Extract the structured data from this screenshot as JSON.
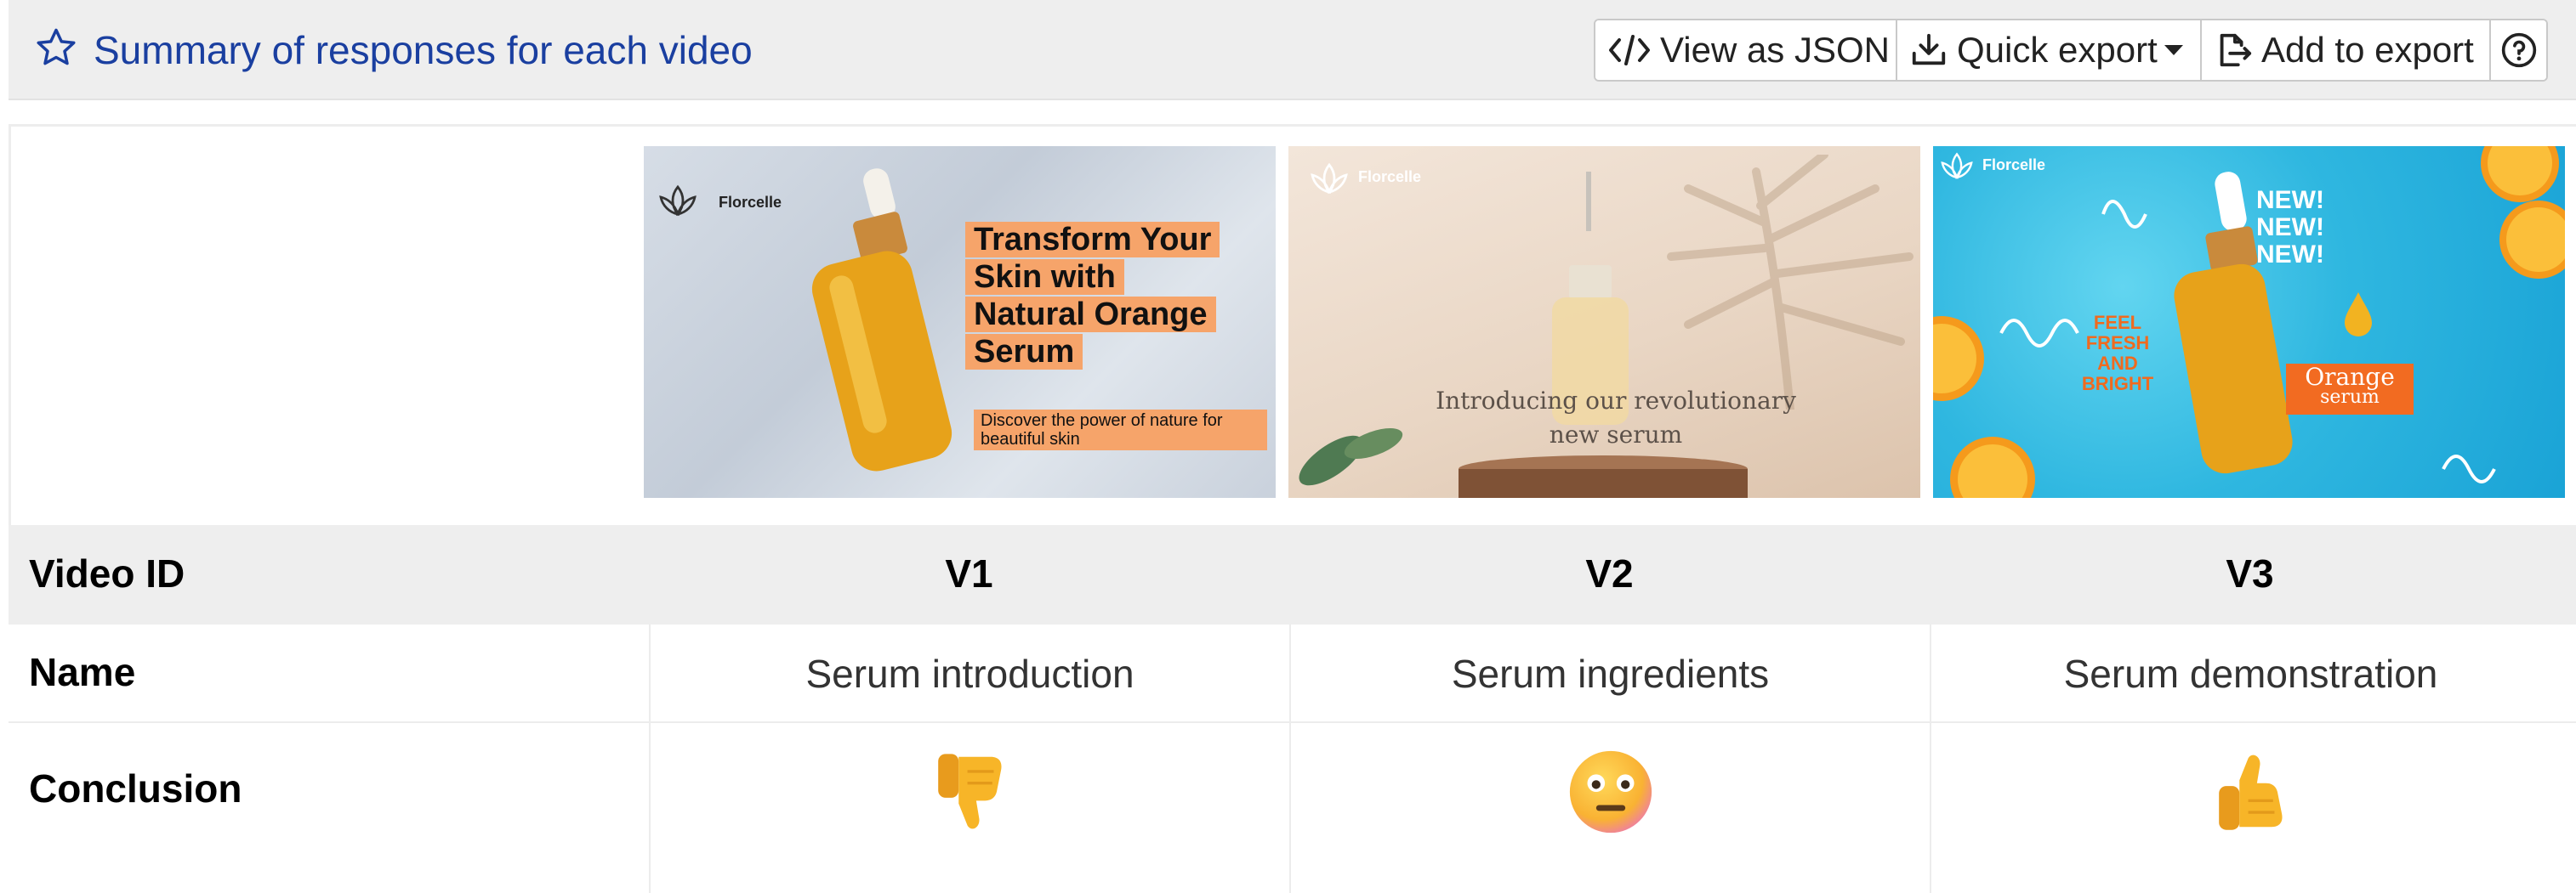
{
  "header": {
    "title": "Summary of responses for each video",
    "buttons": {
      "view_json": "View as JSON",
      "quick_export": "Quick export",
      "add_to_export": "Add to export"
    }
  },
  "thumbnails": [
    {
      "brand": "Florcelle",
      "headline_lines": [
        "Transform Your",
        "Skin with",
        "Natural Orange",
        "Serum"
      ],
      "subline": "Discover the power of nature for beautiful skin"
    },
    {
      "brand": "Florcelle",
      "caption_lines": [
        "Introducing our revolutionary",
        "new serum"
      ]
    },
    {
      "brand": "Florcelle",
      "new_lines": [
        "NEW!",
        "NEW!",
        "NEW!"
      ],
      "fresh_lines": [
        "FEEL",
        "FRESH",
        "AND",
        "BRIGHT"
      ],
      "product_lines": [
        "Orange",
        "serum"
      ]
    }
  ],
  "table": {
    "labels": {
      "video_id": "Video ID",
      "name": "Name",
      "conclusion": "Conclusion"
    },
    "columns": [
      {
        "id": "V1",
        "name": "Serum introduction",
        "conclusion_icon": "thumbs-down"
      },
      {
        "id": "V2",
        "name": "Serum ingredients",
        "conclusion_icon": "neutral-face"
      },
      {
        "id": "V3",
        "name": "Serum demonstration",
        "conclusion_icon": "thumbs-up"
      }
    ]
  },
  "colors": {
    "title": "#1a3fa0",
    "header_bg": "#eeeeee",
    "emoji_yellow": "#f7b528",
    "thumb_accent": "#f6a46a"
  }
}
